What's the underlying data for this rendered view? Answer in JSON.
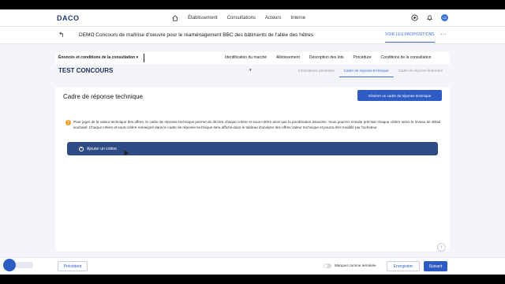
{
  "app": {
    "logo": "DACO"
  },
  "topnav": {
    "links": [
      "Établissement",
      "Consultations",
      "Acteurs",
      "Interne"
    ],
    "avatar_initials": "LG"
  },
  "titlebar": {
    "back_symbol": "↰",
    "title": "DEMO Concours de maîtrise d'oeuvre pour le réaménagement BBC des bâtiments de l'allée des hêtres",
    "view_link": "VOIR LES PROPOSITIONS",
    "more_symbol": "···"
  },
  "section": {
    "selector": "Énoncés et conditions de la consultation ▾",
    "tabs": [
      "Identification du marché",
      "Allotissement",
      "Description des lots",
      "Procédure",
      "Conditions de la consultation"
    ]
  },
  "header": {
    "title": "TEST CONCOURS",
    "dropdown": "▾",
    "subtabs": [
      "Informations générales",
      "Cadre de réponse technique",
      "Cadre de réponse financière"
    ],
    "active_subtab": 1
  },
  "card": {
    "title": "Cadre de réponse technique",
    "action_button": "Générer un cadre de réponse technique",
    "warning": "Pour juger de la valeur technique des offres, le cadre de réponse technique permet de décrire chaque critère et sous-critère ainsi que la pondération associée. Vous pourrez ensuite préciser chaque critère selon le niveau de détail souhaité. Chaque critère et sous-critère renseigné dans le cadre de réponse technique sera affiché dans le tableau d'analyse des offres Valeur technique et pourra être modifié par l'acheteur.",
    "add_label": "Ajouter un critère"
  },
  "footer": {
    "previous": "Précédent",
    "toggle_label": "Marquer comme terminée",
    "save": "Enregistrer",
    "next": "Suivant"
  }
}
